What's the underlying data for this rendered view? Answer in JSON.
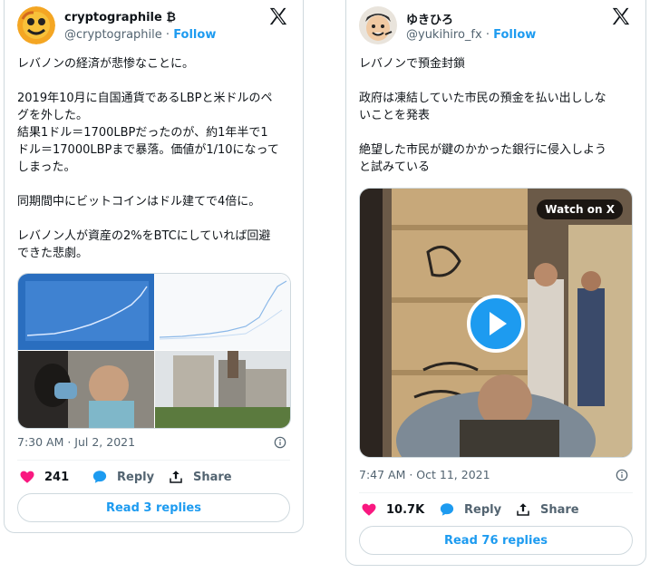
{
  "tweets": [
    {
      "name": "cryptographile",
      "name_badge": "₿",
      "handle": "@cryptographile",
      "separator": "·",
      "follow": "Follow",
      "text": "レバノンの経済が悲惨なことに。\n\n2019年10月に自国通貨であるLBPと米ドルのペ\nグを外した。\n結果1ドル＝1700LBPだったのが、約1年半で1\nドル＝17000LBPまで暴落。価値が1/10になって\nしまった。\n\n同期間中にビットコインはドル建てで4倍に。\n\nレバノン人が資産の2%をBTCにしていれば回避\nできた悲劇。",
      "time": "7:30 AM · Jul 2, 2021",
      "likes": "241",
      "reply_label": "Reply",
      "share_label": "Share",
      "read_replies": "Read 3 replies"
    },
    {
      "name": "ゆきひろ",
      "handle": "@yukihiro_fx",
      "separator": "·",
      "follow": "Follow",
      "text": "レバノンで預金封鎖\n\n政府は凍結していた市民の預金を払い出ししな\nいことを発表\n\n絶望した市民が鍵のかかった銀行に侵入しよう\nと試みている",
      "watch_label": "Watch on X",
      "time": "7:47 AM · Oct 11, 2021",
      "likes": "10.7K",
      "reply_label": "Reply",
      "share_label": "Share",
      "read_replies": "Read 76 replies"
    }
  ],
  "colors": {
    "accent": "#1d9bf0",
    "like": "#f91880",
    "muted": "#536471",
    "border": "#cfd9de"
  }
}
